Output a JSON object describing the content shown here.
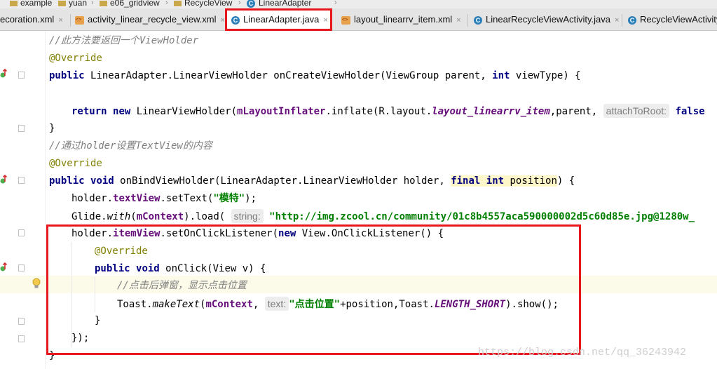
{
  "breadcrumb": [
    "example",
    "yuan",
    "e06_gridview",
    "RecycleView",
    "LinearAdapter"
  ],
  "tabs": [
    {
      "label": "ecoration.xml",
      "icon": "xml-file-icon"
    },
    {
      "label": "activity_linear_recycle_view.xml",
      "icon": "xml-file-icon"
    },
    {
      "label": "LinearAdapter.java",
      "icon": "java-class-icon",
      "active": true
    },
    {
      "label": "layout_linearrv_item.xml",
      "icon": "xml-file-icon"
    },
    {
      "label": "LinearRecycleViewActivity.java",
      "icon": "java-class-icon"
    },
    {
      "label": "RecycleViewActivity",
      "icon": "java-class-icon"
    }
  ],
  "tab_close_glyph": "×",
  "code": {
    "l1_comment": "//此方法要返回一个ViewHolder",
    "l2_annotation": "@Override",
    "l3": {
      "k1": "public ",
      "t1": "LinearAdapter.LinearViewHolder onCreateViewHolder(ViewGroup parent, ",
      "k2": "int",
      "t2": " viewType) {"
    },
    "l5": {
      "k1": "return ",
      "k2": "new ",
      "t1": "LinearViewHolder(",
      "f1": "mLayoutInflater",
      "t2": ".inflate(R.layout.",
      "s1": "layout_linearrv_item",
      "t3": ",parent, ",
      "hint": "attachToRoot:",
      "k3": " false"
    },
    "l6_brace": "}",
    "l7_comment": "//通过holder设置TextView的内容",
    "l8_annotation": "@Override",
    "l9": {
      "k1": "public ",
      "k2": "void ",
      "t1": "onBindViewHolder(LinearAdapter.LinearViewHolder holder, ",
      "k3": "final ",
      "k4": "int ",
      "t2": "position",
      "t3": ") {"
    },
    "l10": {
      "t1": "holder.",
      "f1": "textView",
      "t2": ".setText(",
      "s1": "\"模特\"",
      "t3": ");"
    },
    "l11": {
      "t1": "Glide.",
      "m1": "with",
      "t2": "(",
      "f1": "mContext",
      "t3": ").load( ",
      "hint": "string:",
      "s1": " \"http://img.zcool.cn/community/01c8b4557aca590000002d5c60d85e.jpg@1280w_"
    },
    "l12": {
      "t1": "holder.",
      "f1": "itemView",
      "t2": ".setOnClickListener(",
      "k1": "new ",
      "t3": "View.OnClickListener() {"
    },
    "l13_annotation": "@Override",
    "l14": {
      "k1": "public ",
      "k2": "void ",
      "t1": "onClick(View v) {"
    },
    "l15_comment": "//点击后弹窗，显示点击位置",
    "l16": {
      "t1": "Toast.",
      "m1": "makeText",
      "t2": "(",
      "f1": "mContext",
      "t3": ", ",
      "hint": "text:",
      "s1": "\"点击位置\"",
      "t4": "+position,Toast.",
      "st1": "LENGTH_SHORT",
      "t5": ").show();"
    },
    "l17_brace": "}",
    "l18_close": "});",
    "l19_brace": "}"
  },
  "watermark": "https://blog.csdn.net/qq_36243942",
  "colors": {
    "highlight_box": "#e8171e",
    "keyword": "#000080",
    "annotation": "#808000",
    "comment": "#808080",
    "field": "#660e7a",
    "string": "#008000"
  }
}
